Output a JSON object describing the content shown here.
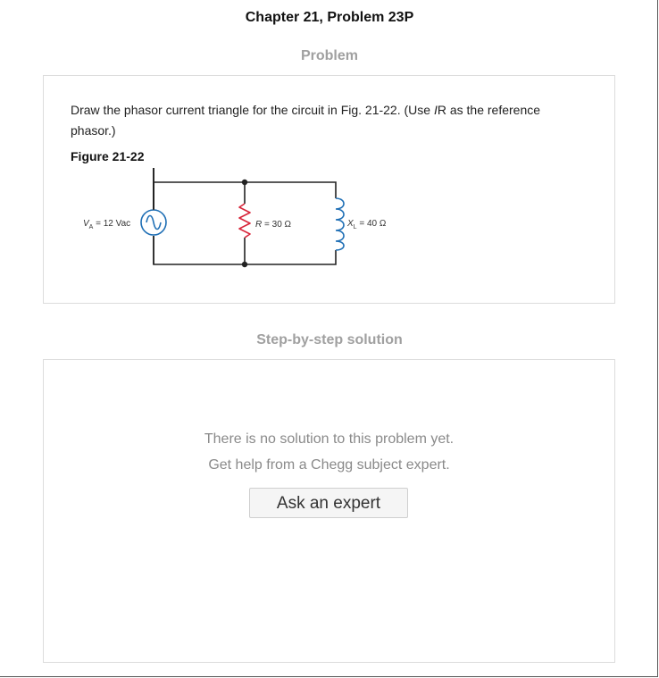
{
  "header": {
    "title": "Chapter 21, Problem 23P"
  },
  "problem": {
    "heading": "Problem",
    "text_before": "Draw the phasor current triangle for the circuit in Fig. 21-22. (Use ",
    "text_italic": "I",
    "text_after": "R as the reference phasor.)",
    "figure_label": "Figure 21-22",
    "circuit": {
      "source_label_var": "V",
      "source_label_sub": "A",
      "source_label_value": " = 12 Vac",
      "resistor_label_var": "R",
      "resistor_label_value": " = 30 Ω",
      "inductor_label_var": "X",
      "inductor_label_sub": "L",
      "inductor_label_value": " = 40 Ω",
      "colors": {
        "source": "#1f6fb5",
        "resistor": "#d8263b",
        "inductor": "#1f6fb5",
        "wire": "#222222"
      }
    }
  },
  "solution": {
    "heading": "Step-by-step solution",
    "message_line1": "There is no solution to this problem yet.",
    "message_line2": "Get help from a Chegg subject expert.",
    "ask_button_label": "Ask an expert"
  }
}
